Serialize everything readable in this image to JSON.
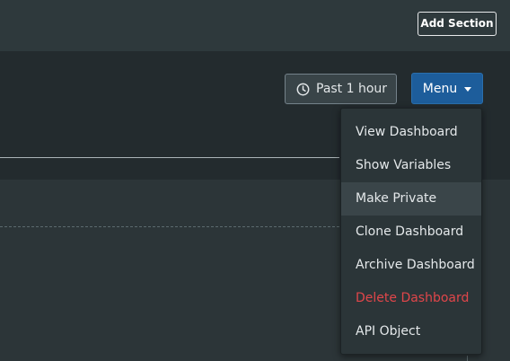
{
  "toolbar": {
    "add_section_label": "Add Section"
  },
  "header": {
    "time_range_label": "Past 1 hour",
    "time_range_icon": "clock-icon",
    "menu_label": "Menu",
    "menu_caret_icon": "caret-down-icon"
  },
  "dropdown": {
    "highlighted_item": "Make Private",
    "danger_color": "#e0464a",
    "items": [
      {
        "label": "View Dashboard"
      },
      {
        "label": "Show Variables"
      },
      {
        "label": "Make Private"
      },
      {
        "label": "Clone Dashboard"
      },
      {
        "label": "Archive Dashboard"
      },
      {
        "label": "Delete Dashboard"
      },
      {
        "label": "API Object"
      }
    ]
  },
  "colors": {
    "accent": "#1d5d9b",
    "background": "#232b2e",
    "topbar": "#2e393c"
  }
}
